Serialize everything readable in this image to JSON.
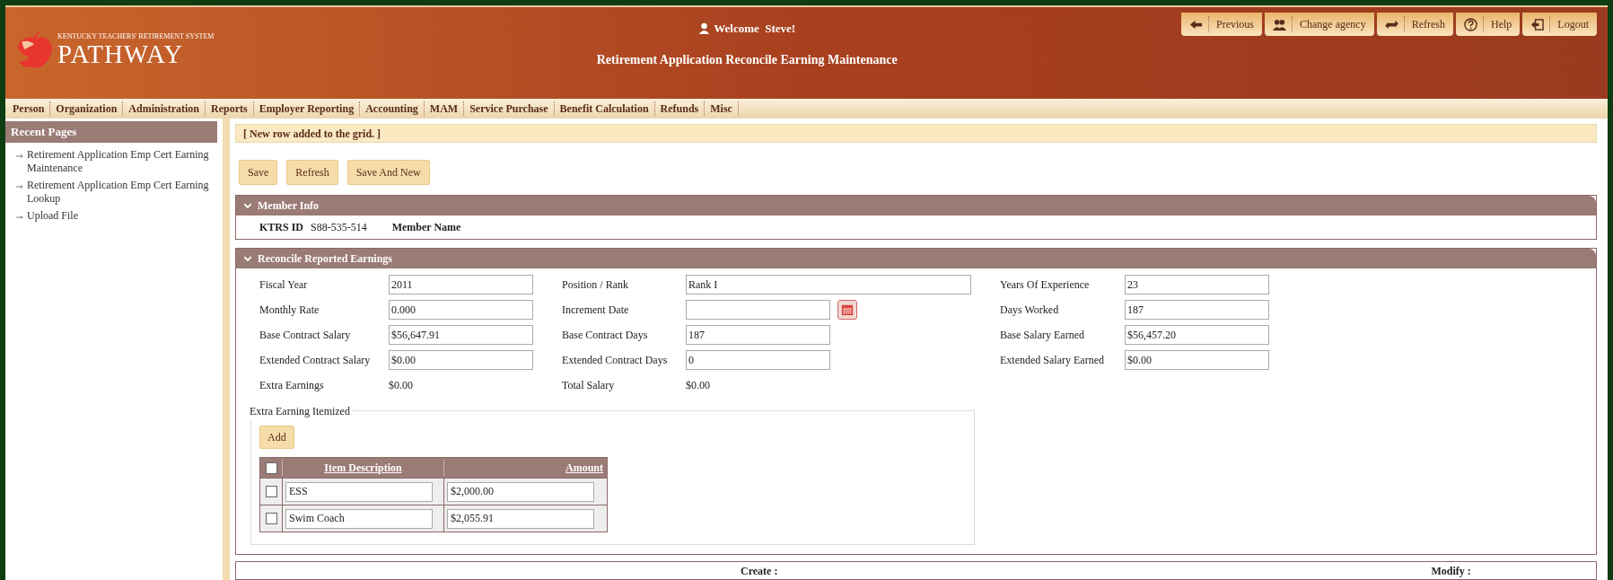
{
  "header": {
    "logo_caption": "KENTUCKY TEACHERS' RETIREMENT SYSTEM",
    "logo_text": "PATHWAY",
    "welcome": "Welcome  Steve!",
    "page_title": "Retirement Application Reconcile Earning Maintenance"
  },
  "top_buttons": [
    {
      "kind": "previous",
      "label": "Previous"
    },
    {
      "kind": "agency",
      "label": "Change agency"
    },
    {
      "kind": "refresh",
      "label": "Refresh"
    },
    {
      "kind": "help",
      "label": "Help"
    },
    {
      "kind": "logout",
      "label": "Logout"
    }
  ],
  "menu": [
    "Person",
    "Organization",
    "Administration",
    "Reports",
    "Employer Reporting",
    "Accounting",
    "MAM",
    "Service Purchase",
    "Benefit Calculation",
    "Refunds",
    "Misc"
  ],
  "sidebar": {
    "title": "Recent Pages",
    "items": [
      "Retirement Application Emp Cert Earning Maintenance",
      "Retirement Application Emp Cert Earning Lookup",
      "Upload File"
    ]
  },
  "message": "[ New row added to the grid. ]",
  "action_buttons": [
    "Save",
    "Refresh",
    "Save And New"
  ],
  "member_info": {
    "title": "Member Info",
    "fields": [
      {
        "label": "KTRS ID",
        "value": "S88-535-514"
      },
      {
        "label": "Member Name"
      }
    ]
  },
  "reconcile": {
    "title": "Reconcile Reported Earnings",
    "columns": [
      [
        {
          "kind": "input",
          "label": "Fiscal Year",
          "value": "2011"
        },
        {
          "kind": "input",
          "label": "Monthly Rate",
          "value": "0.000"
        },
        {
          "kind": "input",
          "label": "Base Contract Salary",
          "value": "$56,647.91"
        },
        {
          "kind": "input",
          "label": "Extended Contract Salary",
          "value": "$0.00"
        },
        {
          "kind": "text",
          "label": "Extra Earnings",
          "value": "$0.00"
        }
      ],
      [
        {
          "kind": "wide",
          "label": "Position / Rank",
          "value": "Rank I"
        },
        {
          "kind": "date",
          "label": "Increment Date"
        },
        {
          "kind": "input",
          "label": "Base Contract Days",
          "value": "187"
        },
        {
          "kind": "input",
          "label": "Extended Contract Days",
          "value": "0"
        },
        {
          "kind": "text",
          "label": "Total Salary",
          "value": "$0.00"
        }
      ],
      [
        {
          "kind": "input",
          "label": "Years Of Experience",
          "value": "23"
        },
        {
          "kind": "input",
          "label": "Days Worked",
          "value": "187"
        },
        {
          "kind": "input",
          "label": "Base Salary Earned",
          "value": "$56,457.20"
        },
        {
          "kind": "input",
          "label": "Extended Salary Earned",
          "value": "$0.00"
        }
      ]
    ]
  },
  "itemized": {
    "legend": "Extra Earning Itemized",
    "add_button": "Add",
    "select_all_checked": false,
    "columns": [
      "Item Description",
      "Amount"
    ],
    "rows": [
      {
        "checked": false,
        "description": "ESS",
        "amount": "$2,000.00"
      },
      {
        "checked": false,
        "description": "Swim Coach",
        "amount": "$2,055.91"
      }
    ]
  },
  "footer": {
    "create": "Create :",
    "modify": "Modify :"
  }
}
